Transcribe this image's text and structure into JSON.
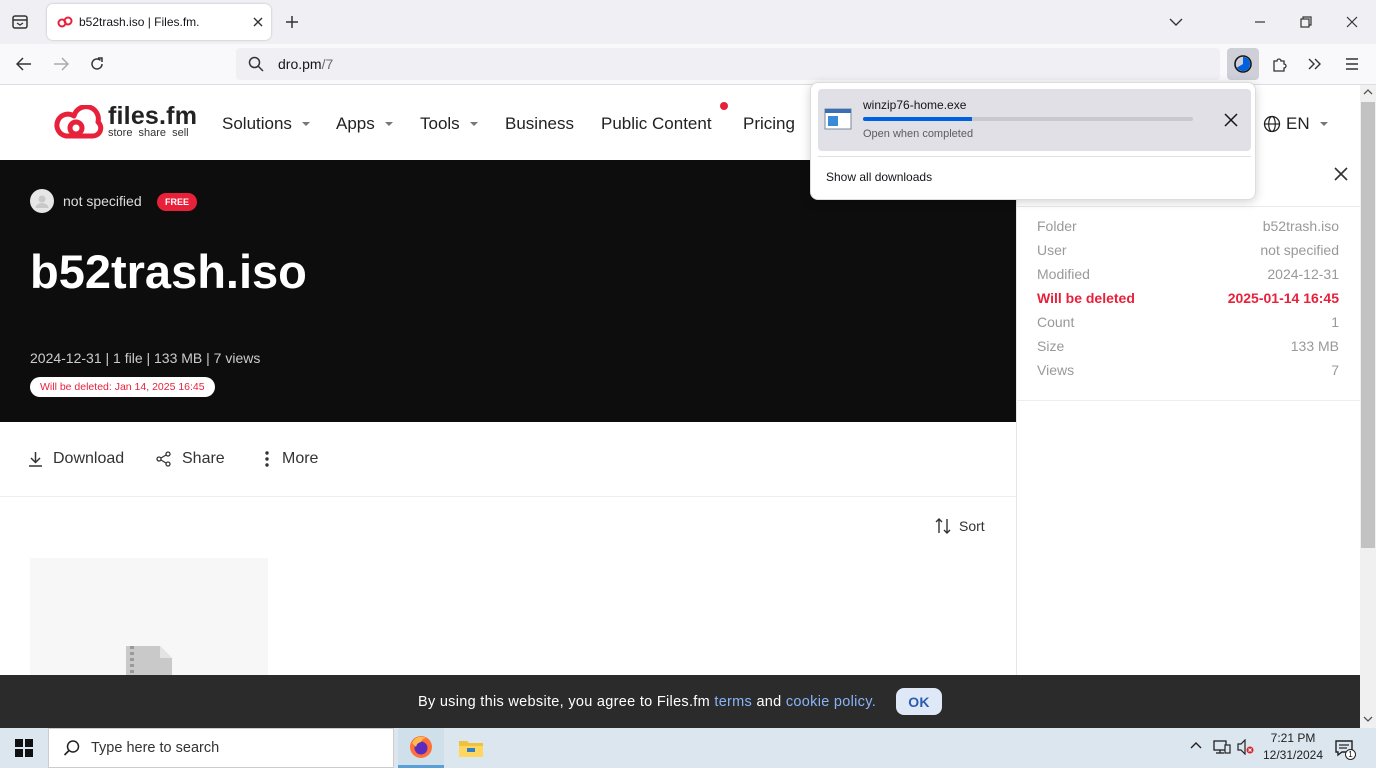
{
  "browser": {
    "tab_title": "b52trash.iso | Files.fm.",
    "url_host": "dro.pm",
    "url_path": "/7"
  },
  "site": {
    "logo_name": "files.fm",
    "logo_tagline": "store share sell",
    "nav": [
      "Solutions",
      "Apps",
      "Tools",
      "Business",
      "Public Content",
      "Pricing"
    ],
    "language": "EN"
  },
  "file": {
    "owner": "not specified",
    "badge": "FREE",
    "title": "b52trash.iso",
    "meta": "2024-12-31 | 1 file | 133 MB | 7 views",
    "deletion_notice": "Will be deleted: Jan 14, 2025 16:45"
  },
  "actions": {
    "download": "Download",
    "share": "Share",
    "more": "More",
    "sort": "Sort"
  },
  "info_panel": {
    "rows": [
      {
        "label": "Folder",
        "value": "b52trash.iso"
      },
      {
        "label": "User",
        "value": "not specified"
      },
      {
        "label": "Modified",
        "value": "2024-12-31"
      },
      {
        "label": "Will be deleted",
        "value": "2025-01-14 16:45"
      },
      {
        "label": "Count",
        "value": "1"
      },
      {
        "label": "Size",
        "value": "133 MB"
      },
      {
        "label": "Views",
        "value": "7"
      }
    ]
  },
  "downloads_popup": {
    "filename": "winzip76-home.exe",
    "status": "Open when completed",
    "progress": 0.33,
    "show_all": "Show all downloads"
  },
  "cookie_bar": {
    "text_before": "By using this website, you agree to Files.fm ",
    "terms": "terms",
    "and": " and ",
    "policy": "cookie policy.",
    "ok": "OK"
  },
  "taskbar": {
    "search_placeholder": "Type here to search",
    "time": "7:21 PM",
    "date": "12/31/2024",
    "notification_count": "1"
  },
  "colors": {
    "brand_red": "#e8213b",
    "hero_bg": "#0d0d0d",
    "progress": "#0061e0"
  }
}
